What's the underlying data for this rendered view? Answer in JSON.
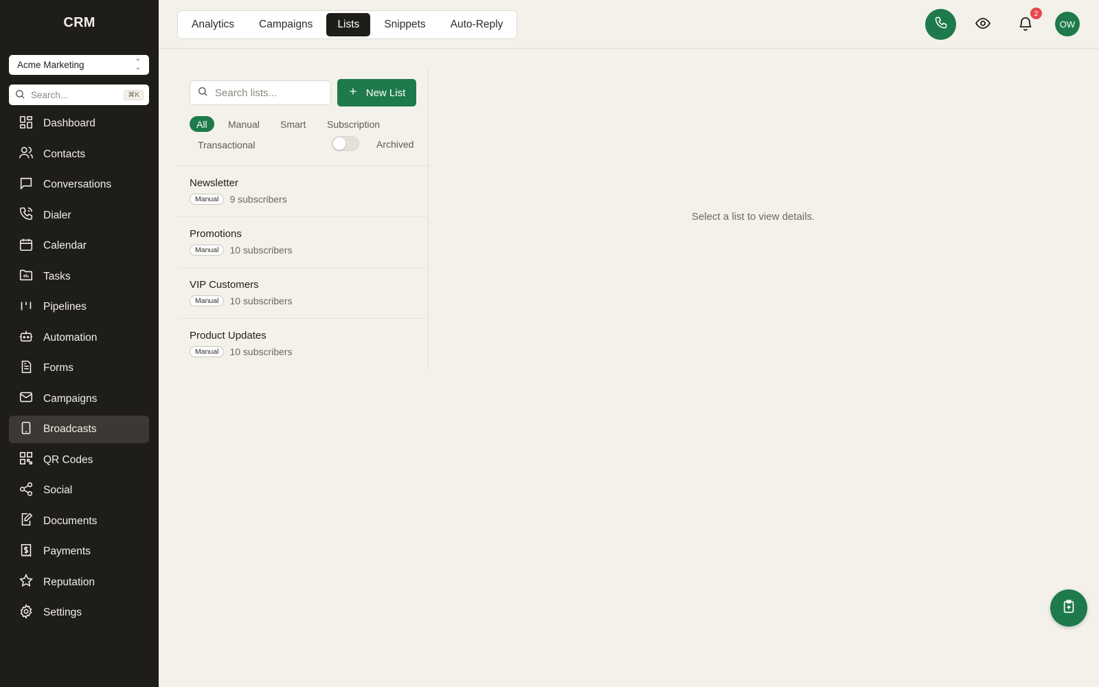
{
  "app": {
    "title": "CRM"
  },
  "workspace": {
    "selected": "Acme Marketing"
  },
  "sidebar_search": {
    "placeholder": "Search...",
    "shortcut": "⌘K"
  },
  "sidebar": {
    "items": [
      {
        "label": "Dashboard",
        "icon": "dashboard-icon"
      },
      {
        "label": "Contacts",
        "icon": "users-icon"
      },
      {
        "label": "Conversations",
        "icon": "chat-icon"
      },
      {
        "label": "Dialer",
        "icon": "phone-icon"
      },
      {
        "label": "Calendar",
        "icon": "calendar-icon"
      },
      {
        "label": "Tasks",
        "icon": "tasks-folder-icon"
      },
      {
        "label": "Pipelines",
        "icon": "pipelines-icon"
      },
      {
        "label": "Automation",
        "icon": "bot-icon"
      },
      {
        "label": "Forms",
        "icon": "form-icon"
      },
      {
        "label": "Campaigns",
        "icon": "mail-icon"
      },
      {
        "label": "Broadcasts",
        "icon": "tablet-icon",
        "active": true
      },
      {
        "label": "QR Codes",
        "icon": "qr-code-icon"
      },
      {
        "label": "Social",
        "icon": "share-icon"
      },
      {
        "label": "Documents",
        "icon": "document-edit-icon"
      },
      {
        "label": "Payments",
        "icon": "receipt-icon"
      },
      {
        "label": "Reputation",
        "icon": "star-icon"
      },
      {
        "label": "Settings",
        "icon": "gear-icon"
      }
    ]
  },
  "tabs": [
    {
      "label": "Analytics"
    },
    {
      "label": "Campaigns"
    },
    {
      "label": "Lists",
      "active": true
    },
    {
      "label": "Snippets"
    },
    {
      "label": "Auto-Reply"
    }
  ],
  "header": {
    "notifications_count": "2",
    "avatar_initials": "OW",
    "accent_color": "#1e7a4b"
  },
  "lists_panel": {
    "search_placeholder": "Search lists...",
    "new_list_label": "New List",
    "filters": [
      "All",
      "Manual",
      "Smart",
      "Subscription",
      "Transactional"
    ],
    "active_filter": "All",
    "archived_label": "Archived",
    "archived_on": false,
    "lists": [
      {
        "name": "Newsletter",
        "type": "Manual",
        "subscribers": "9 subscribers"
      },
      {
        "name": "Promotions",
        "type": "Manual",
        "subscribers": "10 subscribers"
      },
      {
        "name": "VIP Customers",
        "type": "Manual",
        "subscribers": "10 subscribers"
      },
      {
        "name": "Product Updates",
        "type": "Manual",
        "subscribers": "10 subscribers"
      }
    ]
  },
  "detail": {
    "empty_message": "Select a list to view details."
  }
}
